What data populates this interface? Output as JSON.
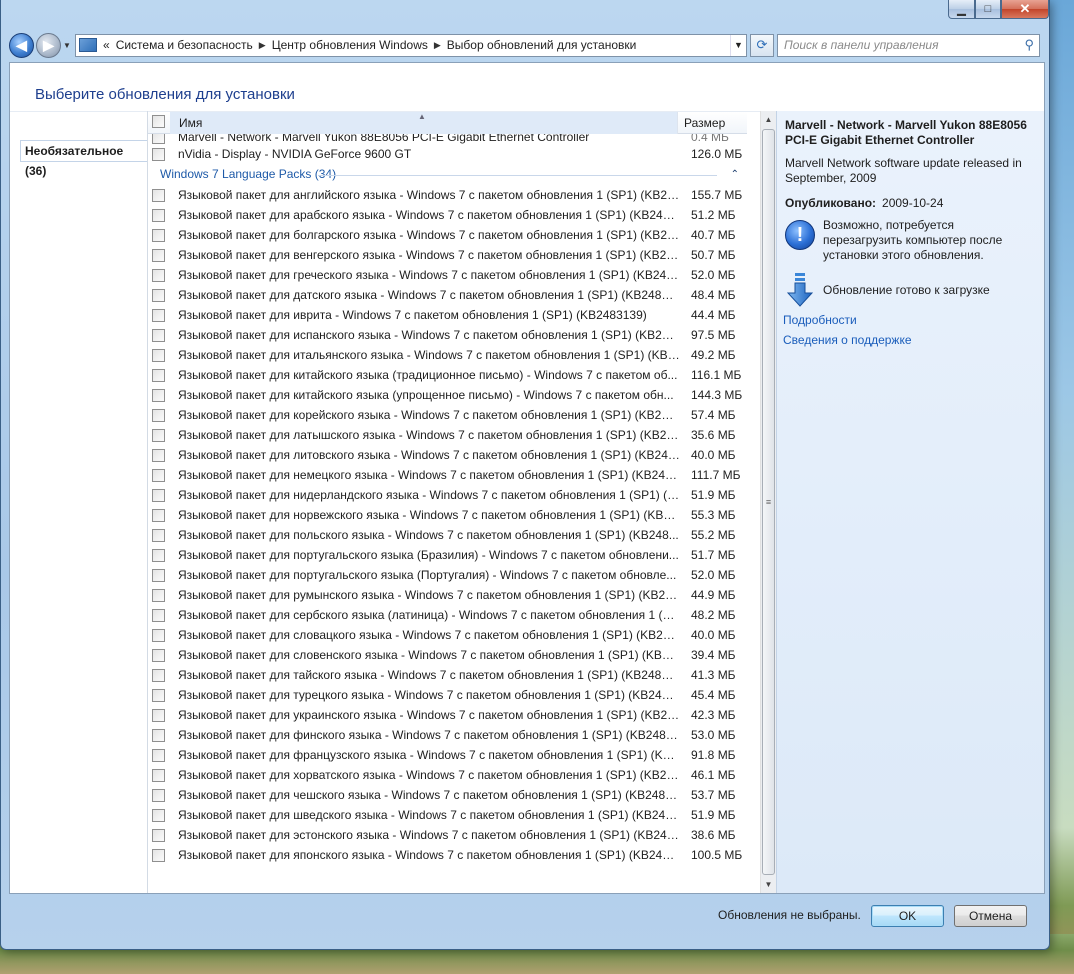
{
  "window": {
    "caption": {
      "minimize": "▁",
      "maximize": "□",
      "close": "✕"
    }
  },
  "nav": {
    "back_icon": "back-arrow-icon",
    "forward_icon": "forward-arrow-icon",
    "breadcrumbs": [
      "Система и безопасность",
      "Центр обновления Windows",
      "Выбор обновлений для установки"
    ],
    "crumb_prefix": "«",
    "search_placeholder": "Поиск в панели управления"
  },
  "page": {
    "title": "Выберите обновления для установки"
  },
  "left_panel": {
    "category_tab": "Необязательное (36)"
  },
  "list": {
    "header_name": "Имя",
    "header_size": "Размер",
    "partial_row": {
      "name": "Marvell - Network - Marvell Yukon 88E8056 PCI-E Gigabit Ethernet Controller",
      "size": "0.4 МБ"
    },
    "top_rows": [
      {
        "name": "nVidia - Display - NVIDIA GeForce 9600 GT",
        "size": "126.0 МБ"
      }
    ],
    "group_title": "Windows 7 Language Packs (34)",
    "group_rows": [
      {
        "name": "Языковой пакет для английского языка - Windows 7 с пакетом обновления 1 (SP1) (KB24...",
        "size": "155.7 МБ"
      },
      {
        "name": "Языковой пакет для арабского языка - Windows 7 с пакетом обновления 1 (SP1) (KB2483...",
        "size": "51.2 МБ"
      },
      {
        "name": "Языковой пакет для болгарского языка - Windows 7 с пакетом обновления 1 (SP1) (KB24...",
        "size": "40.7 МБ"
      },
      {
        "name": "Языковой пакет для венгерского языка - Windows 7 с пакетом обновления 1 (SP1) (KB24...",
        "size": "50.7 МБ"
      },
      {
        "name": "Языковой пакет для греческого языка - Windows 7 с пакетом обновления 1 (SP1) (KB248...",
        "size": "52.0 МБ"
      },
      {
        "name": "Языковой пакет для датского языка - Windows 7 с пакетом обновления 1 (SP1) (KB2483139)",
        "size": "48.4 МБ"
      },
      {
        "name": "Языковой пакет для иврита - Windows 7 с пакетом обновления 1 (SP1) (KB2483139)",
        "size": "44.4 МБ"
      },
      {
        "name": "Языковой пакет для испанского языка - Windows 7 с пакетом обновления 1 (SP1) (KB248...",
        "size": "97.5 МБ"
      },
      {
        "name": "Языковой пакет для итальянского языка - Windows 7 с пакетом обновления 1 (SP1) (KB2...",
        "size": "49.2 МБ"
      },
      {
        "name": "Языковой пакет для китайского языка (традиционное письмо) - Windows 7 с пакетом об...",
        "size": "116.1 МБ"
      },
      {
        "name": "Языковой пакет для китайского языка (упрощенное письмо) - Windows 7 с пакетом обн...",
        "size": "144.3 МБ"
      },
      {
        "name": "Языковой пакет для корейского языка - Windows 7 с пакетом обновления 1 (SP1) (KB248...",
        "size": "57.4 МБ"
      },
      {
        "name": "Языковой пакет для латышского языка - Windows 7 с пакетом обновления 1 (SP1) (KB24...",
        "size": "35.6 МБ"
      },
      {
        "name": "Языковой пакет для литовского языка - Windows 7 с пакетом обновления 1 (SP1) (KB248...",
        "size": "40.0 МБ"
      },
      {
        "name": "Языковой пакет для немецкого языка - Windows 7 с пакетом обновления 1 (SP1) (KB2483...",
        "size": "111.7 МБ"
      },
      {
        "name": "Языковой пакет для нидерландского языка - Windows 7 с пакетом обновления 1 (SP1) (K...",
        "size": "51.9 МБ"
      },
      {
        "name": "Языковой пакет для норвежского языка - Windows 7 с пакетом обновления 1 (SP1) (KB24...",
        "size": "55.3 МБ"
      },
      {
        "name": "Языковой пакет для польского языка - Windows 7 с пакетом обновления 1 (SP1) (KB248...",
        "size": "55.2 МБ"
      },
      {
        "name": "Языковой пакет для португальского языка (Бразилия) - Windows 7 с пакетом обновлени...",
        "size": "51.7 МБ"
      },
      {
        "name": "Языковой пакет для португальского языка (Португалия) - Windows 7 с пакетом обновле...",
        "size": "52.0 МБ"
      },
      {
        "name": "Языковой пакет для румынского языка - Windows 7 с пакетом обновления 1 (SP1) (KB24...",
        "size": "44.9 МБ"
      },
      {
        "name": "Языковой пакет для сербского языка (латиница) - Windows 7 с пакетом обновления 1 (S...",
        "size": "48.2 МБ"
      },
      {
        "name": "Языковой пакет для словацкого языка - Windows 7 с пакетом обновления 1 (SP1) (KB248...",
        "size": "40.0 МБ"
      },
      {
        "name": "Языковой пакет для словенского языка - Windows 7 с пакетом обновления 1 (SP1) (KB24...",
        "size": "39.4 МБ"
      },
      {
        "name": "Языковой пакет для тайского языка - Windows 7 с пакетом обновления 1 (SP1) (KB248313...",
        "size": "41.3 МБ"
      },
      {
        "name": "Языковой пакет для турецкого языка - Windows 7 с пакетом обновления 1 (SP1) (KB2483...",
        "size": "45.4 МБ"
      },
      {
        "name": "Языковой пакет для украинского языка - Windows 7 с пакетом обновления 1 (SP1) (KB24...",
        "size": "42.3 МБ"
      },
      {
        "name": "Языковой пакет для финского языка - Windows 7 с пакетом обновления 1 (SP1) (KB24831...",
        "size": "53.0 МБ"
      },
      {
        "name": "Языковой пакет для французского языка - Windows 7 с пакетом обновления 1 (SP1) (KB2...",
        "size": "91.8 МБ"
      },
      {
        "name": "Языковой пакет для хорватского языка - Windows 7 с пакетом обновления 1 (SP1) (KB248...",
        "size": "46.1 МБ"
      },
      {
        "name": "Языковой пакет для чешского языка - Windows 7 с пакетом обновления 1 (SP1) (KB24831...",
        "size": "53.7 МБ"
      },
      {
        "name": "Языковой пакет для шведского языка - Windows 7 с пакетом обновления 1 (SP1) (KB2483...",
        "size": "51.9 МБ"
      },
      {
        "name": "Языковой пакет для эстонского языка - Windows 7 с пакетом обновления 1 (SP1) (KB248...",
        "size": "38.6 МБ"
      },
      {
        "name": "Языковой пакет для японского языка - Windows 7 с пакетом обновления 1 (SP1) (KB2483...",
        "size": "100.5 МБ"
      }
    ]
  },
  "details": {
    "title": "Marvell - Network - Marvell Yukon 88E8056 PCI-E Gigabit Ethernet Controller",
    "description": "Marvell Network software update released in September, 2009",
    "published_label": "Опубликовано:",
    "published_value": "2009-10-24",
    "restart_note": "Возможно, потребуется перезагрузить компьютер после установки этого обновления.",
    "ready_note": "Обновление готово к загрузке",
    "link_details": "Подробности",
    "link_support": "Сведения о поддержке"
  },
  "footer": {
    "status": "Обновления не выбраны.",
    "ok": "OK",
    "cancel": "Отмена"
  },
  "colors": {
    "accent_link": "#1a5dbb",
    "group_header": "#1e5aa8",
    "page_title": "#1e3f8e"
  }
}
